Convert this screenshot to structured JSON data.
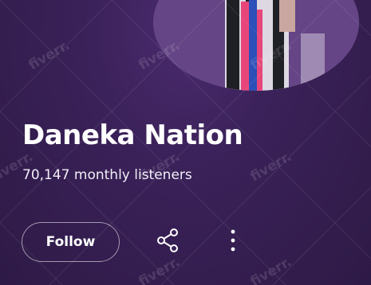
{
  "artist": {
    "name": "Daneka Nation",
    "monthly_listeners": "70,147 monthly listeners"
  },
  "actions": {
    "follow_label": "Follow",
    "share_icon": "share-icon",
    "more_icon": "more-vertical-icon"
  },
  "watermark": {
    "text": "fiverr."
  },
  "colors": {
    "background": "#3a2158",
    "text": "#ffffff",
    "photo_accent_blue": "#2c4fb8",
    "photo_accent_pink": "#e8457a"
  }
}
